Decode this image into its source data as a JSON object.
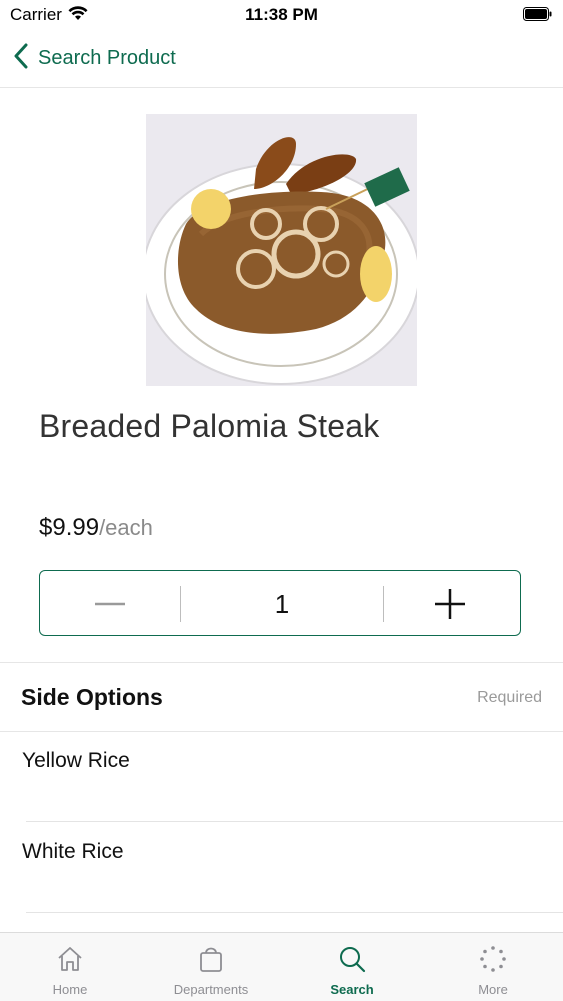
{
  "status_bar": {
    "carrier": "Carrier",
    "time": "11:38 PM"
  },
  "nav": {
    "back_label": "Search Product"
  },
  "product": {
    "title": "Breaded Palomia Steak",
    "price": "$9.99",
    "unit": "/each",
    "image_icon": "food-photo"
  },
  "quantity": {
    "value": "1"
  },
  "side_options": {
    "title": "Side Options",
    "required_label": "Required",
    "items": [
      {
        "label": "Yellow Rice"
      },
      {
        "label": "White Rice"
      }
    ]
  },
  "tab_bar": {
    "items": [
      {
        "label": "Home",
        "icon": "home-icon",
        "active": false
      },
      {
        "label": "Departments",
        "icon": "bag-icon",
        "active": false
      },
      {
        "label": "Search",
        "icon": "search-icon",
        "active": true
      },
      {
        "label": "More",
        "icon": "more-icon",
        "active": false
      }
    ]
  },
  "colors": {
    "accent": "#0e6b4f",
    "inactive": "#8e8e93"
  }
}
